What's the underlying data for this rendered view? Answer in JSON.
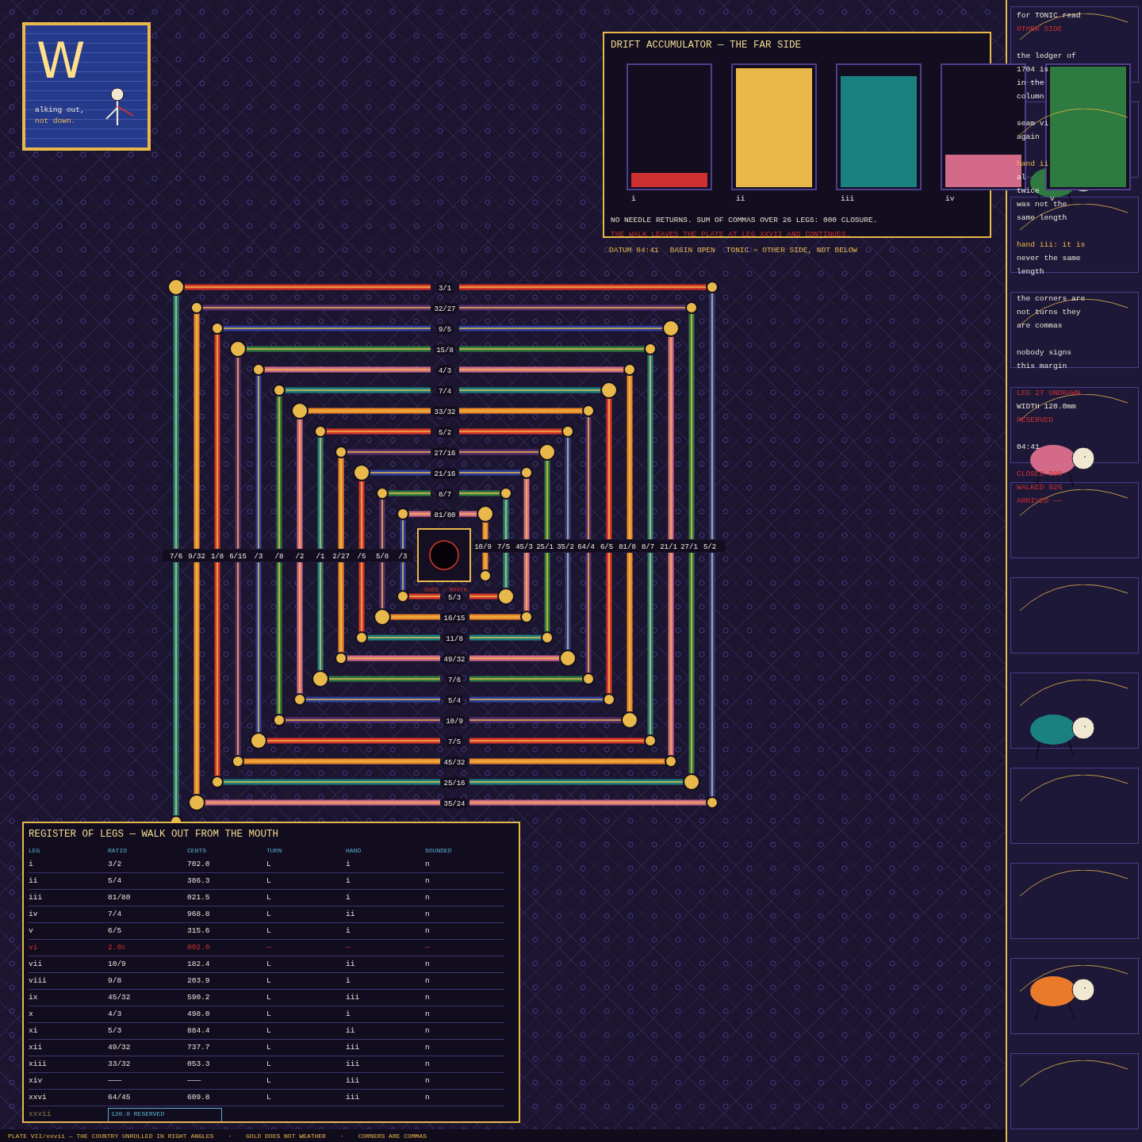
{
  "title_card": {
    "letter": "W",
    "lines": [
      "alking out,",
      "not down."
    ]
  },
  "drift_panel": {
    "title": "DRIFT ACCUMULATOR — THE FAR SIDE",
    "meters": [
      {
        "label": "i",
        "color": "#cc3030",
        "level": 0.12
      },
      {
        "label": "ii",
        "color": "#e8b84a",
        "level": 0.99
      },
      {
        "label": "iii",
        "color": "#1b8080",
        "level": 0.92
      },
      {
        "label": "iv",
        "color": "#d46a8a",
        "level": 0.27
      },
      {
        "label": "v",
        "color": "#2e7a40",
        "level": 1
      }
    ],
    "note": "NO NEEDLE RETURNS. SUM OF COMMAS OVER 26 LEGS: 000 CLOSURE.",
    "warning": "THE WALK LEAVES THE PLATE AT LEG XXVII AND CONTINUES."
  },
  "datum_line": [
    "DATUM 04:41",
    "BASIN OPEN",
    "TONIC = OTHER SIDE, NOT BELOW"
  ],
  "spiral": {
    "mouth_label": "SHED / MOUTH",
    "top_legs": [
      {
        "label": "3/1"
      },
      {
        "label": "32/27"
      },
      {
        "label": "9/5"
      },
      {
        "label": "15/8"
      },
      {
        "label": "4/3"
      },
      {
        "label": "7/4"
      },
      {
        "label": "33/32"
      },
      {
        "label": "5/2"
      },
      {
        "label": "27/16"
      },
      {
        "label": "21/16"
      },
      {
        "label": "8/7"
      },
      {
        "label": "81/80"
      }
    ],
    "left_legs": [
      {
        "label": "7/6"
      },
      {
        "label": "9/32"
      },
      {
        "label": "1/8"
      },
      {
        "label": "6/15"
      },
      {
        "label": "/3"
      },
      {
        "label": "/8"
      },
      {
        "label": "/2"
      },
      {
        "label": "/1"
      },
      {
        "label": "2/27"
      },
      {
        "label": "/5"
      },
      {
        "label": "5/8"
      },
      {
        "label": "/3"
      }
    ],
    "right_legs": [
      {
        "label": "10/9"
      },
      {
        "label": "7/5"
      },
      {
        "label": "45/3"
      },
      {
        "label": "25/1"
      },
      {
        "label": "35/2"
      },
      {
        "label": "64/4"
      },
      {
        "label": "6/5"
      },
      {
        "label": "81/8"
      },
      {
        "label": "8/7"
      },
      {
        "label": "21/1"
      },
      {
        "label": "27/1"
      },
      {
        "label": "5/2"
      }
    ],
    "bottom_legs": [
      {
        "label": "5/3"
      },
      {
        "label": "16/15"
      },
      {
        "label": "11/8"
      },
      {
        "label": "49/32"
      },
      {
        "label": "7/6"
      },
      {
        "label": "5/4"
      },
      {
        "label": "10/9"
      },
      {
        "label": "7/5"
      },
      {
        "label": "45/32"
      },
      {
        "label": "25/16"
      },
      {
        "label": "35/24"
      }
    ]
  },
  "register": {
    "title": "REGISTER OF LEGS — WALK OUT FROM THE MOUTH",
    "columns": [
      "LEG",
      "RATIO",
      "CENTS",
      "TURN",
      "HAND",
      "SOUNDED"
    ],
    "rows": [
      {
        "kind": "leg",
        "cells": [
          "i",
          "3/2",
          "702.0",
          "L",
          "i",
          "n"
        ]
      },
      {
        "kind": "leg",
        "cells": [
          "ii",
          "5/4",
          "386.3",
          "L",
          "i",
          "n"
        ]
      },
      {
        "kind": "leg",
        "cells": [
          "iii",
          "81/80",
          "021.5",
          "L",
          "i",
          "n"
        ]
      },
      {
        "kind": "leg",
        "cells": [
          "iv",
          "7/4",
          "968.8",
          "L",
          "ii",
          "n"
        ]
      },
      {
        "kind": "leg",
        "cells": [
          "v",
          "6/5",
          "315.6",
          "L",
          "i",
          "n"
        ]
      },
      {
        "kind": "void",
        "cells": [
          "vi",
          "2.0c",
          "002.0",
          "—",
          "—",
          "—"
        ]
      },
      {
        "kind": "leg",
        "cells": [
          "vii",
          "10/9",
          "182.4",
          "L",
          "ii",
          "n"
        ]
      },
      {
        "kind": "leg",
        "cells": [
          "viii",
          "9/8",
          "203.9",
          "L",
          "i",
          "n"
        ]
      },
      {
        "kind": "leg",
        "cells": [
          "ix",
          "45/32",
          "590.2",
          "L",
          "iii",
          "n"
        ]
      },
      {
        "kind": "leg",
        "cells": [
          "x",
          "4/3",
          "498.0",
          "L",
          "i",
          "n"
        ]
      },
      {
        "kind": "leg",
        "cells": [
          "xi",
          "5/3",
          "884.4",
          "L",
          "ii",
          "n"
        ]
      },
      {
        "kind": "leg",
        "cells": [
          "xii",
          "49/32",
          "737.7",
          "L",
          "iii",
          "n"
        ]
      },
      {
        "kind": "leg",
        "cells": [
          "xiii",
          "33/32",
          "053.3",
          "L",
          "iii",
          "n"
        ]
      },
      {
        "kind": "leg",
        "cells": [
          "xiv",
          "———",
          "———",
          "L",
          "iii",
          "n"
        ]
      },
      {
        "kind": "leg",
        "cells": [
          "xxvi",
          "64/45",
          "609.8",
          "L",
          "iii",
          "n"
        ]
      },
      {
        "kind": "reserved",
        "cells": [
          "xxvii",
          "120.0 RESERVED"
        ]
      }
    ]
  },
  "footer": {
    "separator": "·",
    "parts": [
      "PLATE VII/xxvii — THE COUNTRY UNROLLED IN RIGHT ANGLES",
      "GOLD DOES NOT WEATHER",
      "CORNERS ARE COMMAS"
    ]
  },
  "margin_notes": [
    [
      {
        "text": "for TONIC read",
        "kind": "plain"
      },
      {
        "text": "OTHER SIDE",
        "kind": "warning"
      }
    ],
    [
      {
        "text": "the ledger of",
        "kind": "plain"
      },
      {
        "text": "1704 is",
        "kind": "plain"
      },
      {
        "text": "in the",
        "kind": "plain"
      },
      {
        "text": "column",
        "kind": "plain"
      }
    ],
    [
      {
        "text": "seam vi",
        "kind": "plain"
      },
      {
        "text": "again",
        "kind": "plain"
      }
    ],
    [
      {
        "text": "hand ii",
        "kind": "highlight"
      },
      {
        "text": "al",
        "kind": "plain"
      },
      {
        "text": "twice",
        "kind": "plain"
      },
      {
        "text": "was not the",
        "kind": "plain"
      },
      {
        "text": "same length",
        "kind": "plain"
      }
    ],
    [
      {
        "text": "hand iii: it is",
        "kind": "highlight"
      },
      {
        "text": "never the same",
        "kind": "plain"
      },
      {
        "text": "length",
        "kind": "plain"
      }
    ],
    [
      {
        "text": "the corners are",
        "kind": "plain"
      },
      {
        "text": "not turns they",
        "kind": "plain"
      },
      {
        "text": "are commas",
        "kind": "plain"
      }
    ],
    [
      {
        "text": "nobody signs",
        "kind": "plain"
      },
      {
        "text": "this margin",
        "kind": "plain"
      }
    ],
    [
      {
        "text": "LEG 27 UNDRAWN",
        "kind": "warning"
      },
      {
        "text": "WIDTH 120.0mm",
        "kind": "plain"
      },
      {
        "text": "RESERVED",
        "kind": "warning"
      }
    ],
    [
      {
        "text": "04:41",
        "kind": "plain"
      }
    ],
    [
      {
        "text": "CLOSED 000",
        "kind": "warning"
      },
      {
        "text": "WALKED 026",
        "kind": "warning"
      },
      {
        "text": "ARRIVED ——",
        "kind": "warning"
      }
    ]
  ],
  "creatures": [
    {
      "color": "#2e7a40"
    },
    {
      "color": "#d46a8a"
    },
    {
      "color": "#1b8080"
    },
    {
      "color": "#e87a2a"
    }
  ]
}
